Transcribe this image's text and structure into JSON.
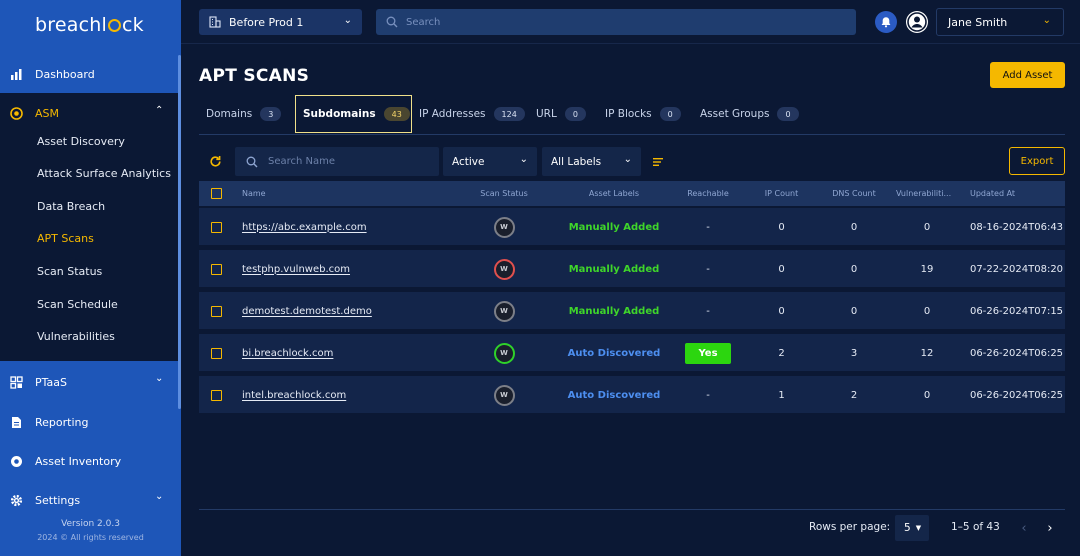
{
  "sidebar": {
    "logo_pre": "breachl",
    "logo_post": "ck",
    "nav": {
      "dashboard": "Dashboard",
      "asm": "ASM",
      "ptaas": "PTaaS",
      "reporting": "Reporting",
      "asset_inventory": "Asset Inventory",
      "settings": "Settings"
    },
    "asm_items": [
      "Asset Discovery",
      "Attack Surface Analytics",
      "Data Breach",
      "APT Scans",
      "Scan Status",
      "Scan Schedule",
      "Vulnerabilities"
    ],
    "active_item": "APT Scans",
    "version": "Version 2.0.3",
    "copyright": "2024 © All rights reserved"
  },
  "topbar": {
    "environment": "Before Prod 1",
    "search_placeholder": "Search",
    "user_name": "Jane Smith"
  },
  "page": {
    "title": "APT SCANS",
    "add_asset_label": "Add Asset"
  },
  "tabs": [
    {
      "label": "Domains",
      "count": "3"
    },
    {
      "label": "Subdomains",
      "count": "43"
    },
    {
      "label": "IP Addresses",
      "count": "124"
    },
    {
      "label": "URL",
      "count": "0"
    },
    {
      "label": "IP Blocks",
      "count": "0"
    },
    {
      "label": "Asset Groups",
      "count": "0"
    }
  ],
  "active_tab": "Subdomains",
  "toolbar": {
    "search_placeholder": "Search Name",
    "status_filter": "Active",
    "label_filter": "All Labels",
    "export_label": "Export"
  },
  "table": {
    "columns": {
      "name": "Name",
      "scan_status": "Scan Status",
      "asset_labels": "Asset Labels",
      "reachable": "Reachable",
      "ip_count": "IP Count",
      "dns_count": "DNS Count",
      "vulnerabilities": "Vulnerabiliti...",
      "updated_at": "Updated At"
    },
    "rows": [
      {
        "name": "https://abc.example.com",
        "scan": "W",
        "scan_color": "#7c7f88",
        "label": "Manually Added",
        "label_type": "manual",
        "reachable": "-",
        "ip": "0",
        "dns": "0",
        "vuln": "0",
        "updated": "08-16-2024T06:43"
      },
      {
        "name": "testphp.vulnweb.com",
        "scan": "W",
        "scan_color": "#e0504e",
        "label": "Manually Added",
        "label_type": "manual",
        "reachable": "-",
        "ip": "0",
        "dns": "0",
        "vuln": "19",
        "updated": "07-22-2024T08:20"
      },
      {
        "name": "demotest.demotest.demo",
        "scan": "W",
        "scan_color": "#7c7f88",
        "label": "Manually Added",
        "label_type": "manual",
        "reachable": "-",
        "ip": "0",
        "dns": "0",
        "vuln": "0",
        "updated": "06-26-2024T07:15"
      },
      {
        "name": "bi.breachlock.com",
        "scan": "W",
        "scan_color": "#2fd12a",
        "label": "Auto Discovered",
        "label_type": "auto",
        "reachable": "Yes",
        "ip": "2",
        "dns": "3",
        "vuln": "12",
        "updated": "06-26-2024T06:25"
      },
      {
        "name": "intel.breachlock.com",
        "scan": "W",
        "scan_color": "#7c7f88",
        "label": "Auto Discovered",
        "label_type": "auto",
        "reachable": "-",
        "ip": "1",
        "dns": "2",
        "vuln": "0",
        "updated": "06-26-2024T06:25"
      }
    ]
  },
  "pagination": {
    "rows_per_page_label": "Rows per page:",
    "rows_per_page": "5",
    "range": "1–5 of 43"
  },
  "colors": {
    "sidebar": "#1e56b8",
    "background": "#0b1834",
    "accent": "#f5b800",
    "manual_label": "#3fd62a",
    "auto_label": "#4d8ff0",
    "reachable_yes": "#2cd60f"
  }
}
